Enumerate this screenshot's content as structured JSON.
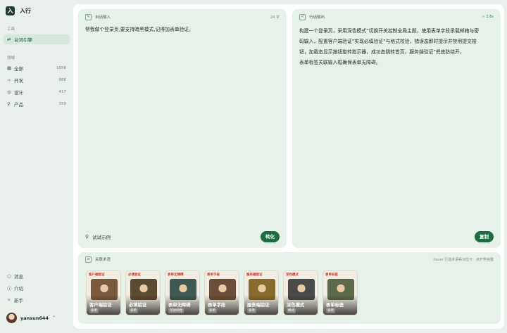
{
  "app": {
    "logo_char": "入",
    "name": "入行"
  },
  "sidebar": {
    "section_tools": "工具",
    "tools": [
      {
        "label": "台词引擎",
        "icon": "translate-icon"
      }
    ],
    "section_domain": "领域",
    "domains": [
      {
        "label": "全部",
        "count": "1656",
        "icon": "grid-icon"
      },
      {
        "label": "开发",
        "count": "888",
        "icon": "code-icon"
      },
      {
        "label": "设计",
        "count": "417",
        "icon": "palette-icon"
      },
      {
        "label": "产品",
        "count": "359",
        "icon": "bulb-icon"
      }
    ],
    "bottom": [
      {
        "label": "消息",
        "icon": "bell-icon"
      },
      {
        "label": "介绍",
        "icon": "info-icon"
      },
      {
        "label": "新手",
        "icon": "sparkle-icon"
      }
    ],
    "user": {
      "name": "yansun644"
    }
  },
  "input_panel": {
    "title": "自话输入",
    "char_count": "24 字",
    "text": "帮我做个登录页,要支持暗黑模式,记得加表单验证。",
    "hint": "试试示例",
    "button": "转化"
  },
  "output_panel": {
    "title": "行话输出",
    "status": "✓ 2.6s",
    "lines": [
      "构建一个登录页，采用深色模式“切换开关控制全局主题，使用表单字段承载邮箱与密",
      "码输入，配置客户端验证”实现必填验证”与格式校验，错误态即时提示并禁用提交按",
      "钮，加载态显示按钮旋转指示器，成功态跳转首页，服务端验证”兜底防绕开，",
      "表单标签关联输入框确保表单无障碍。"
    ],
    "button": "复制"
  },
  "gallery": {
    "title": "关联术语",
    "hint": "hover 行话术语看对应卡 · 点开学完整",
    "cards": [
      {
        "poster": "客户端验证",
        "title": "客户端验证",
        "tag": "表单",
        "art_color": "#7a5a3c"
      },
      {
        "poster": "必填验证",
        "title": "必填验证",
        "tag": "表单",
        "art_color": "#5b4b33"
      },
      {
        "poster": "表单无障碍",
        "title": "表单无障碍",
        "tag": "可访问性",
        "art_color": "#3f5a52"
      },
      {
        "poster": "表单字段",
        "title": "表单字段",
        "tag": "表单",
        "art_color": "#6b4e3a"
      },
      {
        "poster": "服务端验证",
        "title": "服务端验证",
        "tag": "表单",
        "art_color": "#8a6b2e"
      },
      {
        "poster": "深色模式",
        "title": "深色模式",
        "tag": "样式",
        "art_color": "#4a4a4a"
      },
      {
        "poster": "表单标签",
        "title": "表单标签",
        "tag": "表单",
        "art_color": "#5c6a4a"
      }
    ]
  }
}
